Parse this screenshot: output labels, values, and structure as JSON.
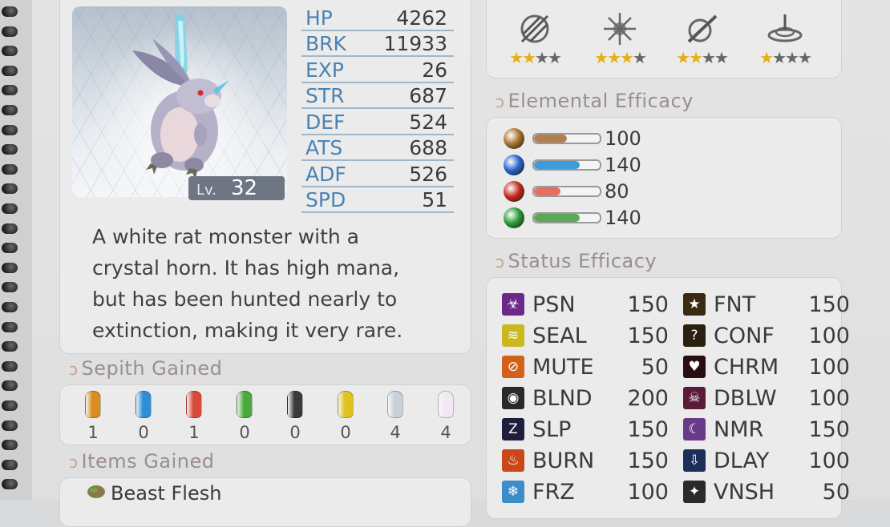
{
  "monster": {
    "level_label": "Lv.",
    "level": "32",
    "description": [
      "A white rat monster with a",
      "crystal horn. It has high mana,",
      "but has been hunted nearly to",
      "extinction, making it very rare."
    ]
  },
  "stats": [
    {
      "label": "HP",
      "value": "4262"
    },
    {
      "label": "BRK",
      "value": "11933"
    },
    {
      "label": "EXP",
      "value": "26"
    },
    {
      "label": "STR",
      "value": "687"
    },
    {
      "label": "DEF",
      "value": "524"
    },
    {
      "label": "ATS",
      "value": "688"
    },
    {
      "label": "ADF",
      "value": "526"
    },
    {
      "label": "SPD",
      "value": "51"
    }
  ],
  "sepith": {
    "title": "Sepith Gained",
    "items": [
      {
        "icon": "earth-sepith-icon",
        "color": "#d98c1f",
        "count": "1"
      },
      {
        "icon": "water-sepith-icon",
        "color": "#2f8fd6",
        "count": "0"
      },
      {
        "icon": "fire-sepith-icon",
        "color": "#d84a3a",
        "count": "1"
      },
      {
        "icon": "wind-sepith-icon",
        "color": "#4aaa3c",
        "count": "0"
      },
      {
        "icon": "time-sepith-icon",
        "color": "#3a3a3a",
        "count": "0"
      },
      {
        "icon": "space-sepith-icon",
        "color": "#e0c21e",
        "count": "0"
      },
      {
        "icon": "mirage-sepith-icon",
        "color": "#c8d0d8",
        "count": "4"
      },
      {
        "icon": "mass-sepith-icon",
        "color": "#f0e8f2",
        "count": "4"
      }
    ]
  },
  "items": {
    "title": "Items Gained",
    "list": [
      {
        "label": "Beast Flesh",
        "icon": "beast-flesh-icon"
      }
    ]
  },
  "arts_resist": [
    {
      "icon": "physical-impede-icon",
      "stars": 2,
      "max": 4
    },
    {
      "icon": "magic-burst-icon",
      "stars": 3,
      "max": 4
    },
    {
      "icon": "sword-slash-icon",
      "stars": 2,
      "max": 4
    },
    {
      "icon": "ground-wave-icon",
      "stars": 1,
      "max": 4
    }
  ],
  "elemental": {
    "title": "Elemental Efficacy",
    "rows": [
      {
        "icon": "earth-orb-icon",
        "color": "#a9732d",
        "fill_color": "#b08050",
        "value": "100",
        "fraction": 0.5
      },
      {
        "icon": "water-orb-icon",
        "color": "#2766c8",
        "fill_color": "#3f9ad8",
        "value": "140",
        "fraction": 0.7
      },
      {
        "icon": "fire-orb-icon",
        "color": "#c62b22",
        "fill_color": "#e57060",
        "value": "80",
        "fraction": 0.4
      },
      {
        "icon": "wind-orb-icon",
        "color": "#2d9c36",
        "fill_color": "#5aa95a",
        "value": "140",
        "fraction": 0.7
      }
    ]
  },
  "status": {
    "title": "Status Efficacy",
    "left": [
      {
        "icon": "poison-icon",
        "color": "#6b2a8a",
        "label": "PSN",
        "value": "150"
      },
      {
        "icon": "seal-icon",
        "color": "#c9b820",
        "label": "SEAL",
        "value": "150"
      },
      {
        "icon": "mute-icon",
        "color": "#d2621a",
        "label": "MUTE",
        "value": "50"
      },
      {
        "icon": "blind-icon",
        "color": "#2a2a2a",
        "label": "BLND",
        "value": "200"
      },
      {
        "icon": "sleep-icon",
        "color": "#1e1e3c",
        "label": "SLP",
        "value": "150"
      },
      {
        "icon": "burn-icon",
        "color": "#c8481a",
        "label": "BURN",
        "value": "150"
      },
      {
        "icon": "freeze-icon",
        "color": "#3d8ec8",
        "label": "FRZ",
        "value": "100"
      }
    ],
    "right": [
      {
        "icon": "faint-icon",
        "color": "#3a2a10",
        "label": "FNT",
        "value": "150"
      },
      {
        "icon": "confuse-icon",
        "color": "#2a2010",
        "label": "CONF",
        "value": "100"
      },
      {
        "icon": "charm-icon",
        "color": "#2a0d12",
        "label": "CHRM",
        "value": "100"
      },
      {
        "icon": "deathblow-icon",
        "color": "#5a1a3a",
        "label": "DBLW",
        "value": "100"
      },
      {
        "icon": "nightmare-icon",
        "color": "#6a3a8a",
        "label": "NMR",
        "value": "150"
      },
      {
        "icon": "delay-icon",
        "color": "#1e2e5a",
        "label": "DLAY",
        "value": "100"
      },
      {
        "icon": "vanish-icon",
        "color": "#2a2a2a",
        "label": "VNSH",
        "value": "50"
      }
    ]
  }
}
